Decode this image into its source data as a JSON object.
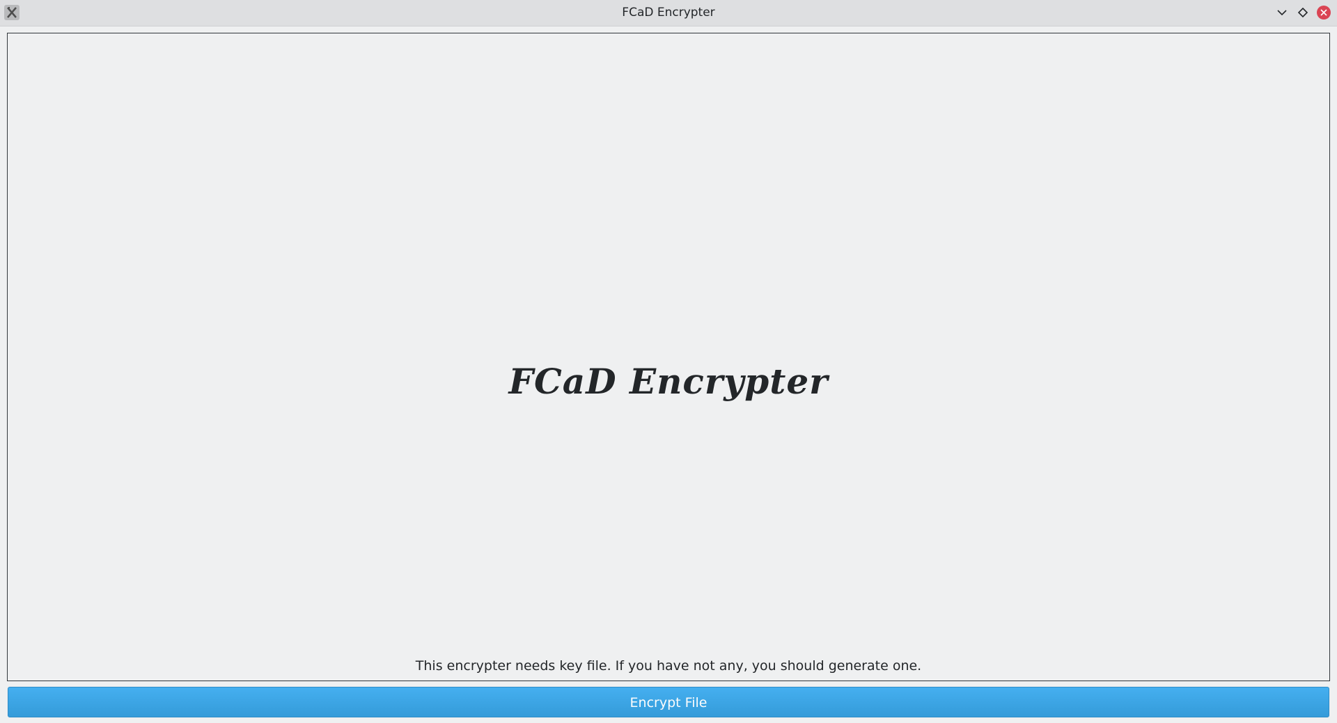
{
  "window": {
    "title": "FCaD Encrypter",
    "app_icon": "x-app-icon",
    "controls": [
      "minimize-icon",
      "maximize-icon",
      "close-icon"
    ]
  },
  "main": {
    "logo_text": "FCaD Encrypter",
    "message": "This encrypter needs key file. If you have not any, you should generate one."
  },
  "actions": {
    "encrypt_label": "Encrypt File"
  },
  "colors": {
    "button": "#3daee9",
    "close": "#da4453",
    "background": "#eff0f1"
  }
}
